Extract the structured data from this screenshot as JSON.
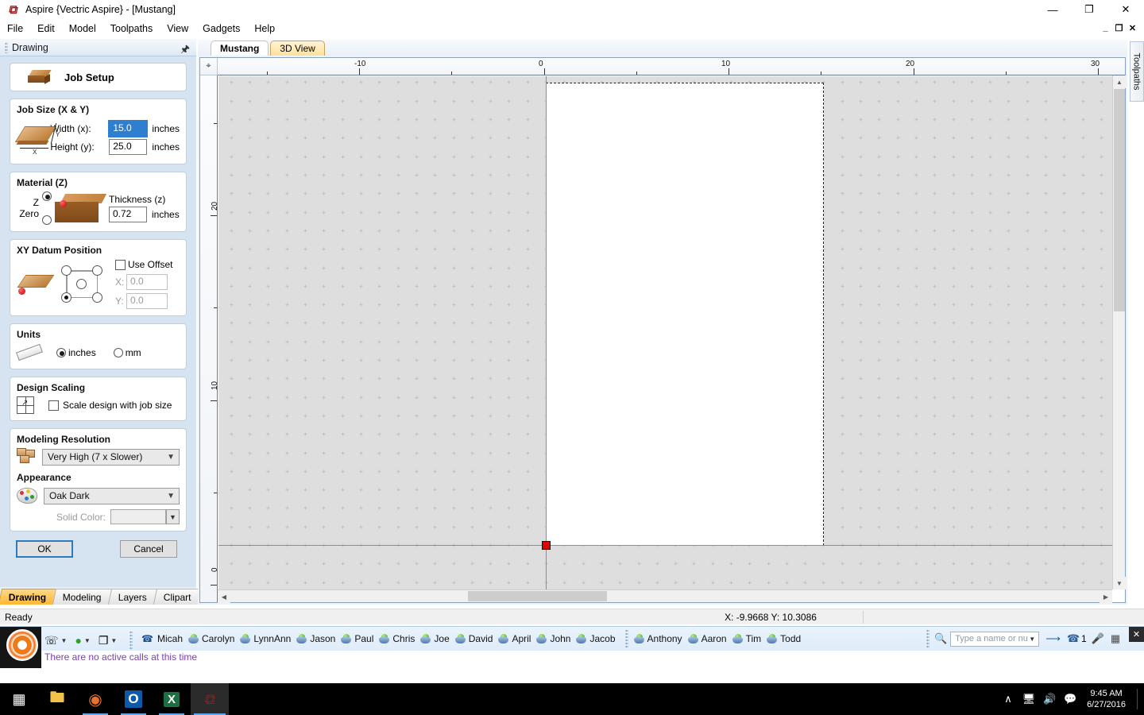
{
  "window": {
    "title": "Aspire {Vectric Aspire} - [Mustang]",
    "app_icon": "aspire-icon",
    "controls": {
      "minimize": "—",
      "maximize": "❐",
      "close": "✕"
    },
    "mdi_controls": {
      "minimize": "_",
      "restore": "❐",
      "close": "✕"
    }
  },
  "menu": {
    "items": [
      "File",
      "Edit",
      "Model",
      "Toolpaths",
      "View",
      "Gadgets",
      "Help"
    ]
  },
  "left_panel": {
    "caption": "Drawing",
    "pin_icon": "pin-icon",
    "job_setup": {
      "label": "Job Setup",
      "icon": "wood-block-icon"
    },
    "job_size": {
      "title": "Job Size (X & Y)",
      "width_label": "Width (x):",
      "width_value": "15.0",
      "width_units": "inches",
      "height_label": "Height (y):",
      "height_value": "25.0",
      "height_units": "inches",
      "axis_x": "X",
      "axis_y": "Y"
    },
    "material": {
      "title": "Material (Z)",
      "z_zero_label": "Z Zero",
      "z_zero_selected": "top",
      "thickness_label": "Thickness (z)",
      "thickness_value": "0.72",
      "thickness_units": "inches"
    },
    "xy_datum": {
      "title": "XY Datum Position",
      "selected": "bottom-left",
      "use_offset_label": "Use Offset",
      "use_offset_checked": false,
      "x_label": "X:",
      "x_value": "0.0",
      "y_label": "Y:",
      "y_value": "0.0"
    },
    "units": {
      "title": "Units",
      "inches_label": "inches",
      "mm_label": "mm",
      "selected": "inches"
    },
    "design_scaling": {
      "title": "Design Scaling",
      "checkbox_label": "Scale design with job size",
      "checked": false
    },
    "modeling_resolution": {
      "title": "Modeling Resolution",
      "value": "Very High (7 x Slower)"
    },
    "appearance": {
      "title": "Appearance",
      "value": "Oak Dark",
      "solid_color_label": "Solid Color:",
      "solid_color_hex": "#eeeeee"
    },
    "buttons": {
      "ok": "OK",
      "cancel": "Cancel"
    },
    "tabs": [
      {
        "label": "Drawing",
        "active": true
      },
      {
        "label": "Modeling",
        "active": false
      },
      {
        "label": "Layers",
        "active": false
      },
      {
        "label": "Clipart",
        "active": false
      }
    ]
  },
  "document": {
    "tabs": [
      {
        "label": "Mustang",
        "active": true
      },
      {
        "label": "3D View",
        "active": false
      }
    ],
    "h_ruler_labels": [
      "-10",
      "0",
      "10",
      "20",
      "30"
    ],
    "v_ruler_labels": [
      "20",
      "10",
      "0"
    ],
    "corner_icon": "ruler-origin-icon",
    "canvas": {
      "material_fill": "#ffffff",
      "background": "#dedede",
      "datum_marker_color": "#e00000"
    },
    "scrollbars": {
      "up": "▲",
      "down": "▼",
      "left": "◀",
      "right": "▶"
    }
  },
  "right_tab": {
    "label": "Toolpaths"
  },
  "statusbar": {
    "ready": "Ready",
    "coords": "X: -9.9668 Y: 10.3086"
  },
  "comms": {
    "status_text": "There are no active calls at this time",
    "search_placeholder": "Type a name or nu",
    "call_count": "1",
    "close_label": "✕",
    "active_caller": "Micah",
    "contacts_group_1": [
      "Carolyn",
      "LynnAnn",
      "Jason",
      "Paul",
      "Chris",
      "Joe",
      "David",
      "April",
      "John",
      "Jacob"
    ],
    "contacts_group_2": [
      "Anthony",
      "Aaron",
      "Tim",
      "Todd"
    ]
  },
  "taskbar": {
    "items": [
      {
        "name": "start-button",
        "glyph": "⊞"
      },
      {
        "name": "file-explorer",
        "glyph": "὜0"
      },
      {
        "name": "firefox",
        "glyph": "●"
      },
      {
        "name": "outlook",
        "glyph": "O"
      },
      {
        "name": "excel",
        "glyph": "X"
      },
      {
        "name": "aspire",
        "glyph": "╱"
      }
    ],
    "tray": {
      "chevron": "∧",
      "network": "὚7",
      "volume": "ὐa",
      "action_center": "὞a"
    },
    "time": "9:45 AM",
    "date": "6/27/2016"
  }
}
